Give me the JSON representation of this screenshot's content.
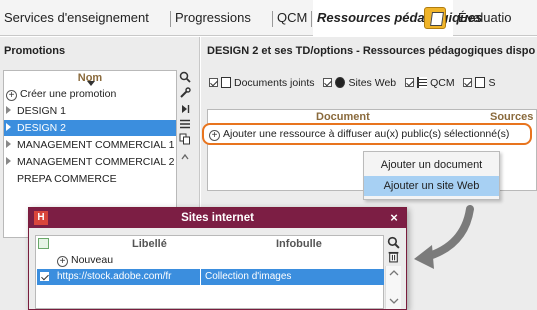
{
  "tabs": [
    {
      "label": "Services d'enseignement"
    },
    {
      "label": "Progressions"
    },
    {
      "label": "QCM"
    },
    {
      "label": "Ressources pédagogiques"
    },
    {
      "label": "Évaluatio"
    }
  ],
  "left": {
    "title": "Promotions",
    "column": "Nom",
    "create_label": "Créer une promotion",
    "items": [
      {
        "label": "DESIGN 1"
      },
      {
        "label": "DESIGN 2"
      },
      {
        "label": "MANAGEMENT COMMERCIAL 1"
      },
      {
        "label": "MANAGEMENT COMMERCIAL 2"
      },
      {
        "label": "PREPA COMMERCE"
      }
    ]
  },
  "right": {
    "title": "DESIGN 2 et ses TD/options - Ressources pédagogiques dispo",
    "filters": {
      "docs": "Documents joints",
      "web": "Sites Web",
      "qcm": "QCM",
      "s": "S"
    },
    "columns": {
      "document": "Document",
      "sources": "Sources"
    },
    "add_resource": "Ajouter une ressource à diffuser au(x) public(s) sélectionné(s)"
  },
  "menu": {
    "add_document": "Ajouter un document",
    "add_website": "Ajouter un site Web"
  },
  "dialog": {
    "logo": "H",
    "title": "Sites internet",
    "close": "×",
    "columns": {
      "libelle": "Libellé",
      "infobulle": "Infobulle"
    },
    "new_label": "Nouveau",
    "rows": [
      {
        "url": "https://stock.adobe.com/fr",
        "tooltip": "Collection d'images"
      }
    ]
  },
  "colors": {
    "selection": "#3b8ede",
    "highlight_border": "#e8741e",
    "dialog_bar": "#7c1e44",
    "menu_hover": "#a7d0f3"
  }
}
